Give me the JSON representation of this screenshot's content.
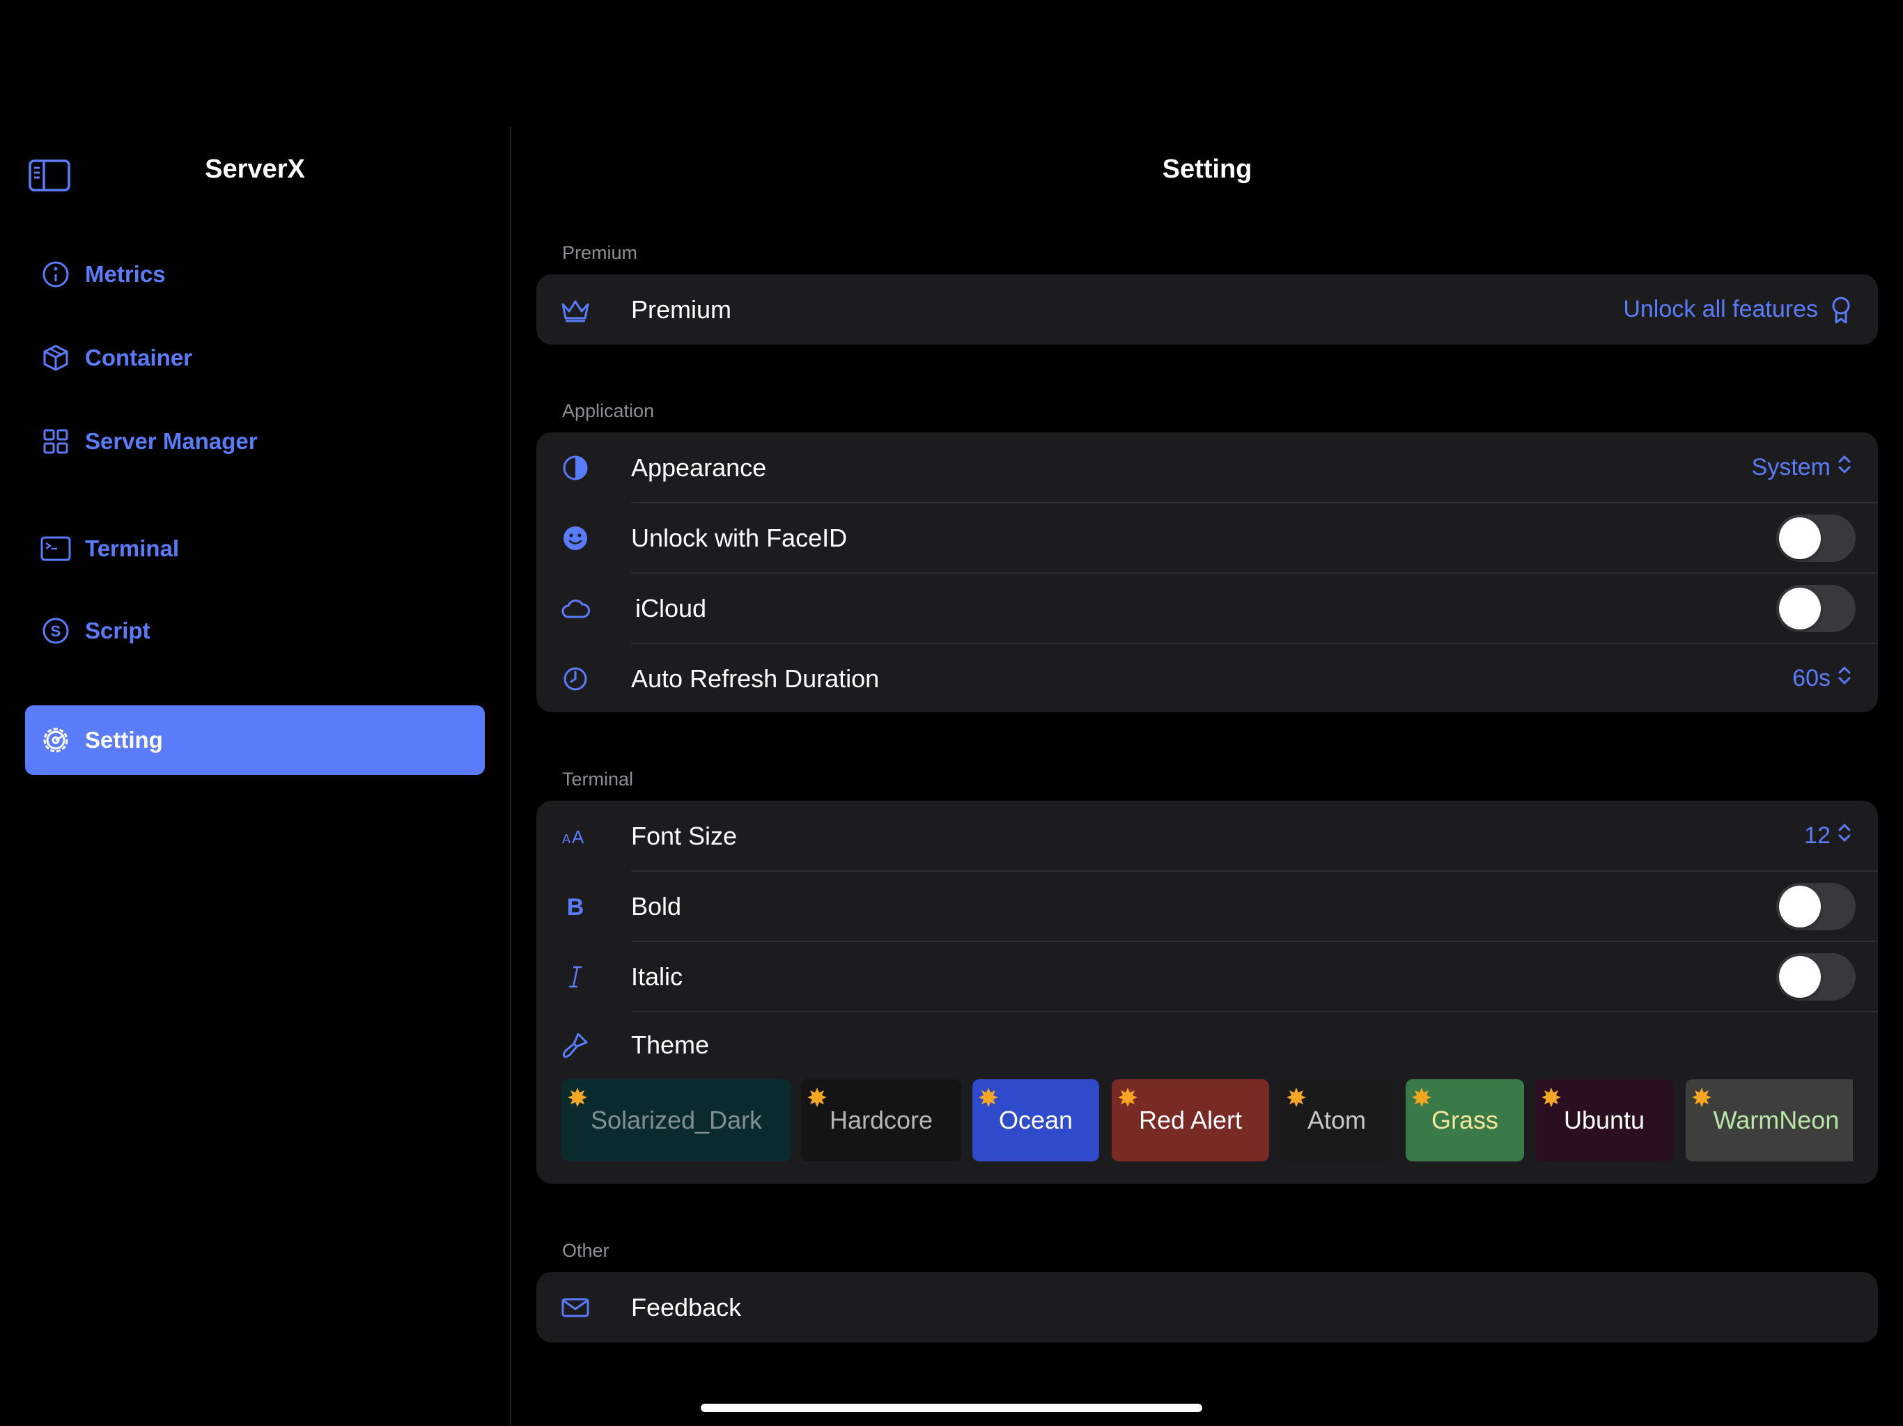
{
  "sidebar": {
    "app_title": "ServerX",
    "toggle_icon": "sidebar-toggle-icon",
    "items": [
      {
        "label": "Metrics",
        "icon": "gauge-icon"
      },
      {
        "label": "Container",
        "icon": "cube-icon"
      },
      {
        "label": "Server Manager",
        "icon": "grid-icon"
      },
      {
        "label": "Terminal",
        "icon": "terminal-icon"
      },
      {
        "label": "Script",
        "icon": "script-icon"
      },
      {
        "label": "Setting",
        "icon": "gear-icon",
        "active": true
      }
    ]
  },
  "main": {
    "title": "Setting",
    "premium": {
      "header": "Premium",
      "label": "Premium",
      "action": "Unlock all features"
    },
    "application": {
      "header": "Application",
      "appearance": {
        "label": "Appearance",
        "value": "System"
      },
      "faceid": {
        "label": "Unlock with FaceID",
        "on": false
      },
      "icloud": {
        "label": "iCloud",
        "on": false
      },
      "refresh": {
        "label": "Auto Refresh Duration",
        "value": "60s"
      }
    },
    "terminal": {
      "header": "Terminal",
      "font_size": {
        "label": "Font Size",
        "value": "12"
      },
      "bold": {
        "label": "Bold",
        "on": false
      },
      "italic": {
        "label": "Italic",
        "on": false
      },
      "theme": {
        "label": "Theme"
      },
      "themes": [
        {
          "name": "Solarized_Dark",
          "bg": "#0a2a2e",
          "fg": "#7f8f92"
        },
        {
          "name": "Hardcore",
          "bg": "#141414",
          "fg": "#b5b5b5"
        },
        {
          "name": "Ocean",
          "bg": "#2f4bcc",
          "fg": "#ffffff"
        },
        {
          "name": "Red Alert",
          "bg": "#7a2a25",
          "fg": "#ffffff"
        },
        {
          "name": "Atom",
          "bg": "#1a1a1b",
          "fg": "#c8c8c8"
        },
        {
          "name": "Grass",
          "bg": "#3a7a48",
          "fg": "#f3e59a"
        },
        {
          "name": "Ubuntu",
          "bg": "#2a0f22",
          "fg": "#ffffff"
        },
        {
          "name": "WarmNeon",
          "bg": "#3e3e3c",
          "fg": "#b8e6a6"
        }
      ]
    },
    "other": {
      "header": "Other",
      "feedback": {
        "label": "Feedback"
      }
    }
  },
  "colors": {
    "accent": "#5b7cfa",
    "card": "#1c1c1e",
    "background": "#000000",
    "sun": "#f5a623"
  }
}
